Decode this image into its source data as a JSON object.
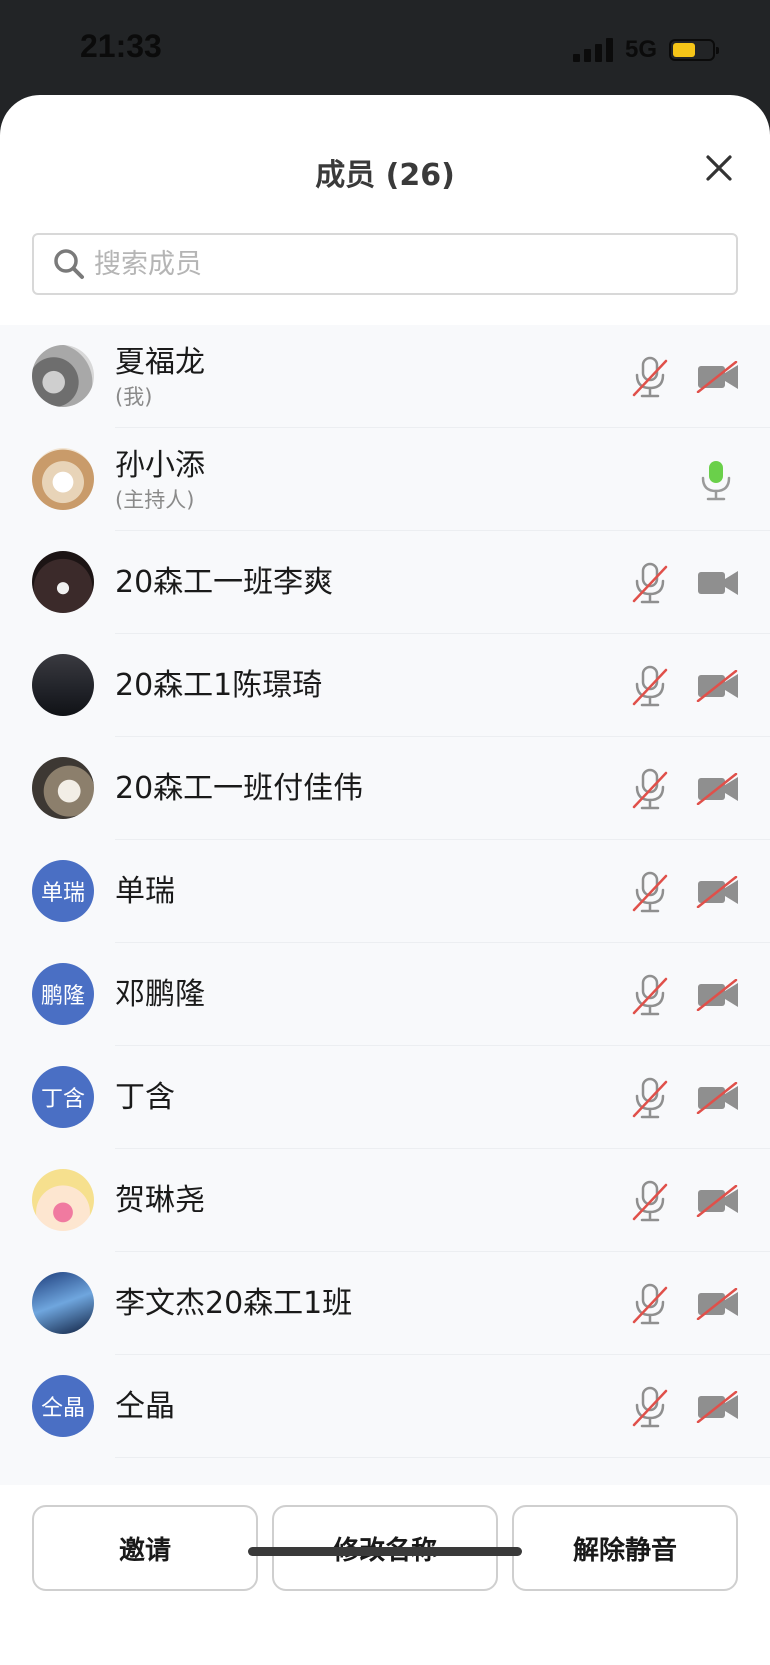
{
  "status_bar": {
    "time": "21:33",
    "network": "5G",
    "battery_color": "#f5c518"
  },
  "header": {
    "title": "成员 (26)",
    "close_icon": "close-icon"
  },
  "search": {
    "placeholder": "搜索成员",
    "value": ""
  },
  "members": [
    {
      "name": "夏福龙",
      "role": "(我)",
      "avatar": "photo-gray",
      "mic": "muted",
      "camera": "off"
    },
    {
      "name": "孙小添",
      "role": "(主持人)",
      "avatar": "photo-cat",
      "mic": "speaking",
      "camera": "none"
    },
    {
      "name": "20森工一班李爽",
      "role": "",
      "avatar": "photo-jersey",
      "mic": "muted",
      "camera": "on"
    },
    {
      "name": "20森工1陈璟琦",
      "role": "",
      "avatar": "photo-person",
      "mic": "muted",
      "camera": "off"
    },
    {
      "name": "20森工一班付佳伟",
      "role": "",
      "avatar": "photo-cats",
      "mic": "muted",
      "camera": "off"
    },
    {
      "name": "单瑞",
      "role": "",
      "avatar": "单瑞",
      "mic": "muted",
      "camera": "off"
    },
    {
      "name": "邓鹏隆",
      "role": "",
      "avatar": "鹏隆",
      "mic": "muted",
      "camera": "off"
    },
    {
      "name": "丁含",
      "role": "",
      "avatar": "丁含",
      "mic": "muted",
      "camera": "off"
    },
    {
      "name": "贺琳尧",
      "role": "",
      "avatar": "photo-anime",
      "mic": "muted",
      "camera": "off"
    },
    {
      "name": "李文杰20森工1班",
      "role": "",
      "avatar": "photo-blue",
      "mic": "muted",
      "camera": "off"
    },
    {
      "name": "仝晶",
      "role": "",
      "avatar": "仝晶",
      "mic": "muted",
      "camera": "off"
    }
  ],
  "footer": {
    "invite": "邀请",
    "rename": "修改名称",
    "unmute": "解除静音"
  },
  "colors": {
    "avatar_text_bg": "#4a6fc4",
    "muted_slash": "#e0504a",
    "speaking_mic": "#6ad04a",
    "icon_gray": "#8f8f8f"
  }
}
